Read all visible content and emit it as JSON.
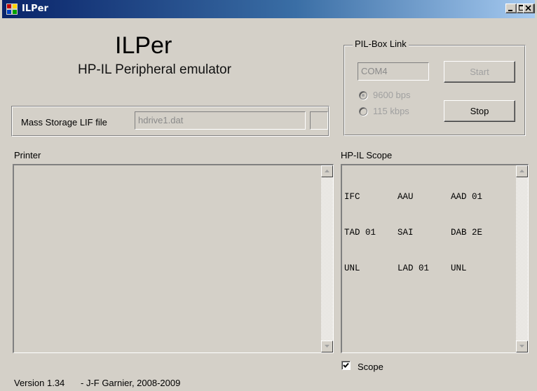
{
  "window": {
    "title": "ILPer"
  },
  "header": {
    "title": "ILPer",
    "subtitle": "HP-IL Peripheral emulator"
  },
  "mass_storage": {
    "label": "Mass Storage LIF file",
    "file_value": "hdrive1.dat"
  },
  "pil_box": {
    "legend": "PIL-Box Link",
    "port_value": "COM4",
    "start_label": "Start",
    "stop_label": "Stop",
    "rates": [
      {
        "label": "9600 bps",
        "selected": true
      },
      {
        "label": "115 kbps",
        "selected": false
      }
    ]
  },
  "printer": {
    "label": "Printer"
  },
  "scope": {
    "label": "HP-IL Scope",
    "rows": [
      [
        "IFC",
        "AAU",
        "AAD 01"
      ],
      [
        "TAD 01",
        "SAI",
        "DAB 2E"
      ],
      [
        "UNL",
        "LAD 01",
        "UNL"
      ]
    ],
    "checkbox_label": "Scope",
    "checkbox_checked": true
  },
  "footer": {
    "version": "Version 1.34",
    "author": "- J-F Garnier, 2008-2009"
  }
}
